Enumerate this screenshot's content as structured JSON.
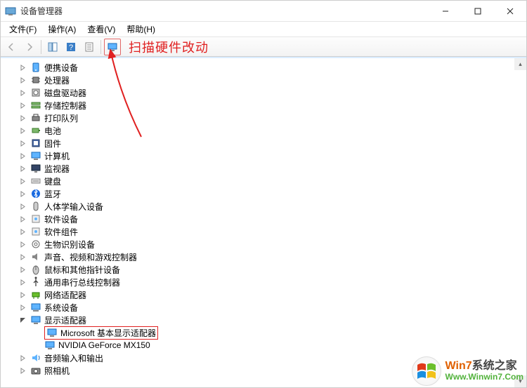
{
  "window": {
    "title": "设备管理器",
    "controls": {
      "min": "minimize",
      "max": "maximize",
      "close": "close"
    }
  },
  "menu": {
    "file": "文件(F)",
    "action": "操作(A)",
    "view": "查看(V)",
    "help": "帮助(H)"
  },
  "annotation": {
    "tooltip": "扫描硬件改动"
  },
  "tree": {
    "items": [
      {
        "label": "便携设备",
        "expandable": true,
        "icon": "portable"
      },
      {
        "label": "处理器",
        "expandable": true,
        "icon": "cpu"
      },
      {
        "label": "磁盘驱动器",
        "expandable": true,
        "icon": "disk"
      },
      {
        "label": "存储控制器",
        "expandable": true,
        "icon": "storage"
      },
      {
        "label": "打印队列",
        "expandable": true,
        "icon": "printer"
      },
      {
        "label": "电池",
        "expandable": true,
        "icon": "battery"
      },
      {
        "label": "固件",
        "expandable": true,
        "icon": "firmware"
      },
      {
        "label": "计算机",
        "expandable": true,
        "icon": "computer"
      },
      {
        "label": "监视器",
        "expandable": true,
        "icon": "monitor"
      },
      {
        "label": "键盘",
        "expandable": true,
        "icon": "keyboard"
      },
      {
        "label": "蓝牙",
        "expandable": true,
        "icon": "bluetooth"
      },
      {
        "label": "人体学输入设备",
        "expandable": true,
        "icon": "hid"
      },
      {
        "label": "软件设备",
        "expandable": true,
        "icon": "software"
      },
      {
        "label": "软件组件",
        "expandable": true,
        "icon": "software"
      },
      {
        "label": "生物识别设备",
        "expandable": true,
        "icon": "biometric"
      },
      {
        "label": "声音、视频和游戏控制器",
        "expandable": true,
        "icon": "sound"
      },
      {
        "label": "鼠标和其他指针设备",
        "expandable": true,
        "icon": "mouse"
      },
      {
        "label": "通用串行总线控制器",
        "expandable": true,
        "icon": "usb"
      },
      {
        "label": "网络适配器",
        "expandable": true,
        "icon": "network"
      },
      {
        "label": "系统设备",
        "expandable": true,
        "icon": "system"
      },
      {
        "label": "显示适配器",
        "expandable": true,
        "expanded": true,
        "icon": "display",
        "children": [
          {
            "label": "Microsoft 基本显示适配器",
            "icon": "display",
            "highlighted": true
          },
          {
            "label": "NVIDIA GeForce MX150",
            "icon": "display"
          }
        ]
      },
      {
        "label": "音频输入和输出",
        "expandable": true,
        "icon": "audio"
      },
      {
        "label": "照相机",
        "expandable": true,
        "icon": "camera"
      }
    ]
  },
  "watermark": {
    "brand_accent": "Win7",
    "brand_rest": "系统之家",
    "url": "Www.Winwin7.Com"
  }
}
